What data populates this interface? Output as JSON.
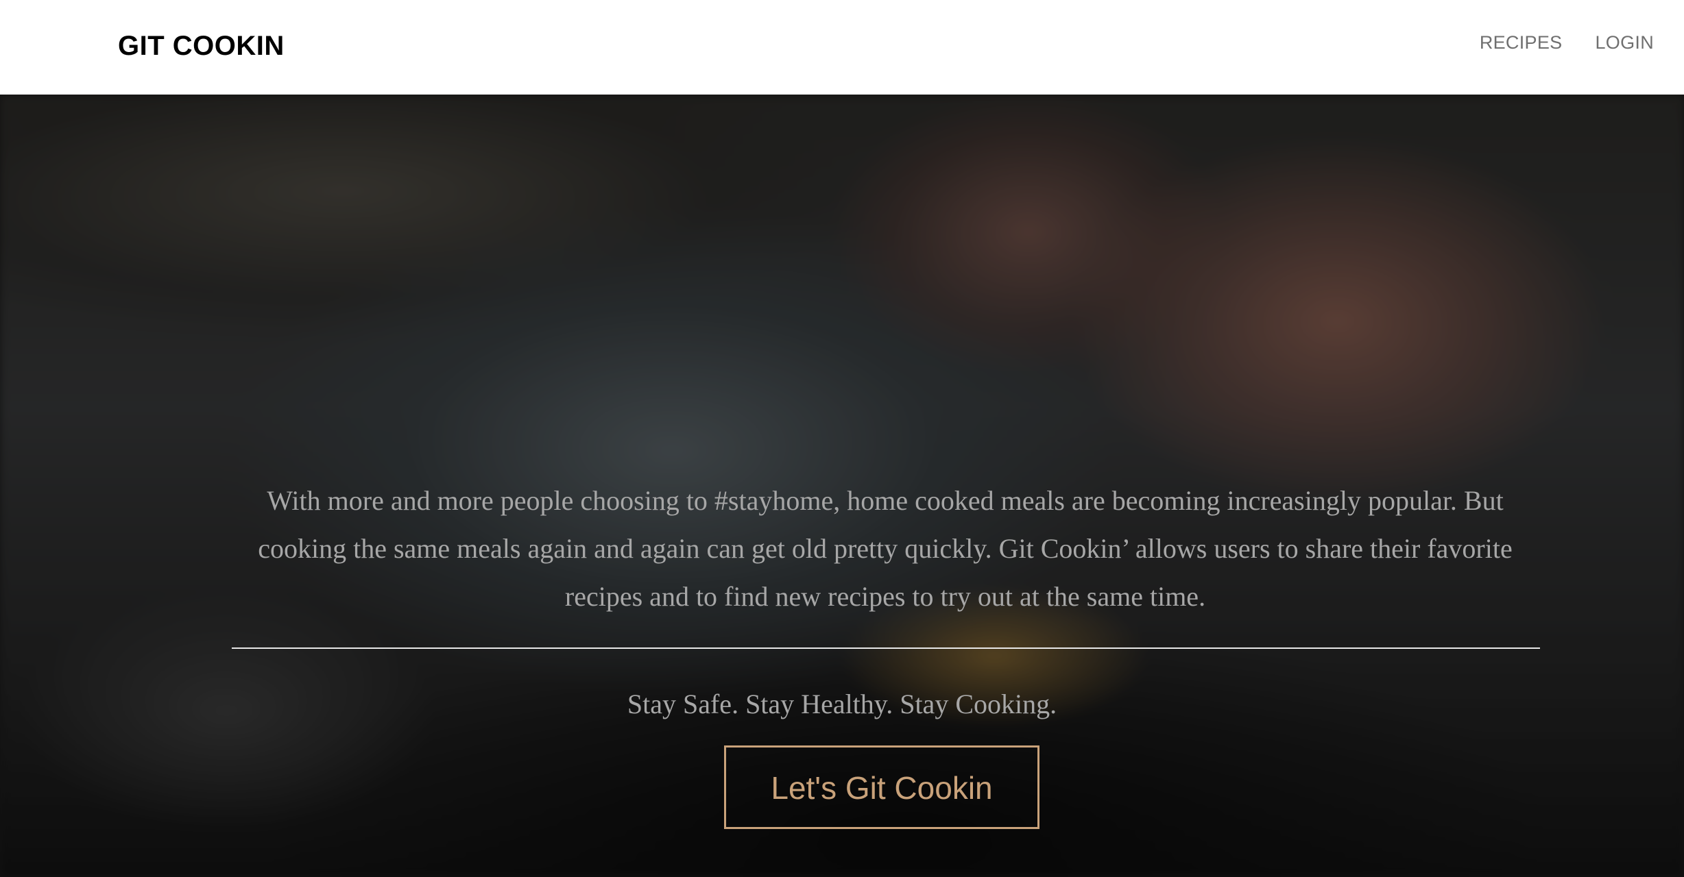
{
  "header": {
    "brand": "GIT COOKIN",
    "nav": [
      {
        "label": "RECIPES"
      },
      {
        "label": "LOGIN"
      }
    ]
  },
  "hero": {
    "description": "With more and more people choosing to #stayhome, home cooked meals are becoming increasingly popular. But cooking the same meals again and again can get old pretty quickly. Git Cookin’ allows users to share their favorite recipes and to find new recipes to try out at the same time.",
    "tagline": "Stay Safe. Stay Healthy. Stay Cooking.",
    "cta_label": "Let's Git Cookin"
  },
  "colors": {
    "accent": "#c9a27a",
    "nav_text": "#6f6f6f",
    "hero_text": "#a7a7a7"
  }
}
